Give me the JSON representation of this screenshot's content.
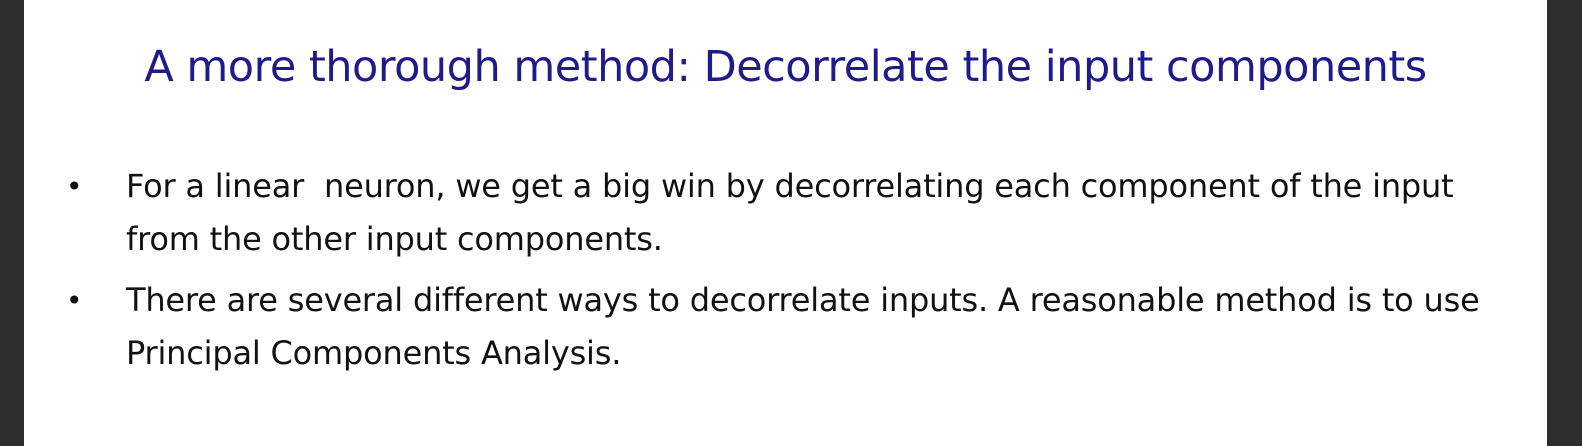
{
  "slide": {
    "title": "A more thorough method: Decorrelate the input components",
    "bullets": [
      {
        "marker": "•",
        "text": "For a linear  neuron, we get a big win by decorrelating each component of the input from the other input components."
      },
      {
        "marker": "•",
        "text": "There are several different ways to decorrelate inputs. A reasonable method is to use Principal Components Analysis."
      }
    ],
    "colors": {
      "title": "#211a8a",
      "body": "#111111",
      "background": "#ffffff",
      "frame": "#2d2d2d"
    }
  }
}
